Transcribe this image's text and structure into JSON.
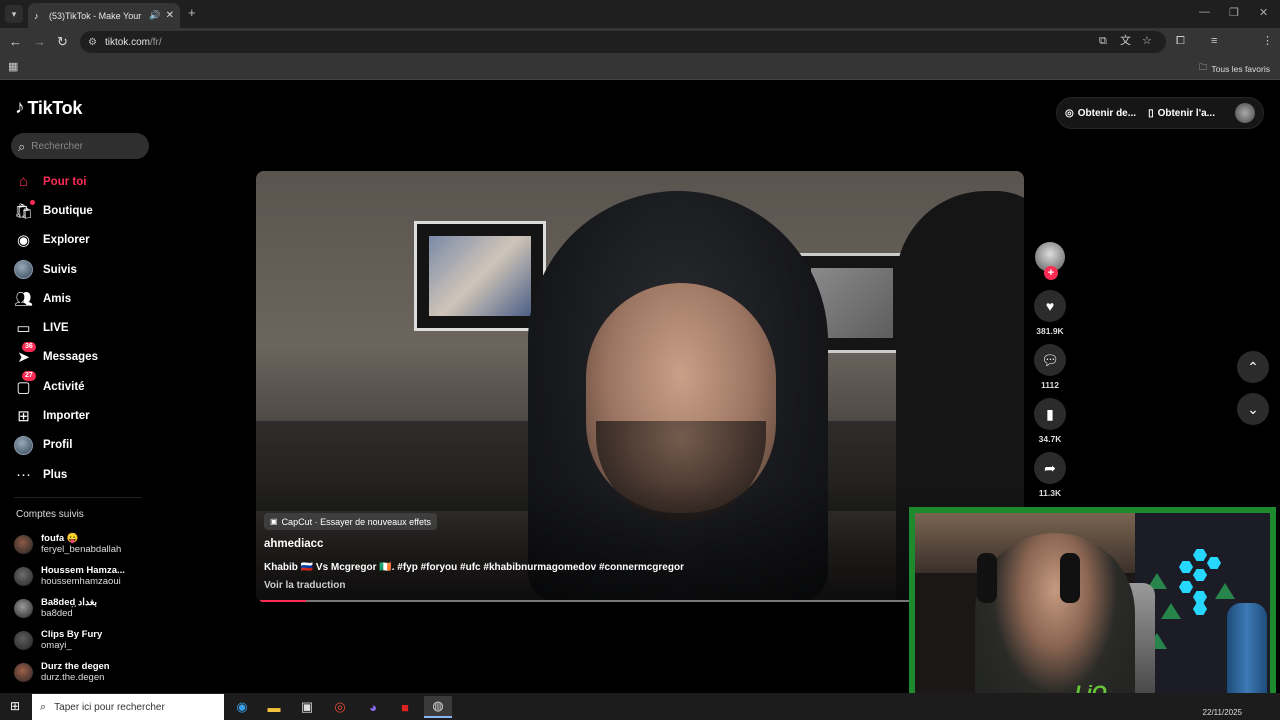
{
  "browser": {
    "tab_title": "(53)TikTok - Make Your Day",
    "url_host": "tiktok.com",
    "url_path": "/fr/",
    "bookmarks_all": "Tous les favoris"
  },
  "tiktok": {
    "logo": "TikTok",
    "search_placeholder": "Rechercher",
    "nav": [
      {
        "label": "Pour toi",
        "icon": "home-icon",
        "active": true
      },
      {
        "label": "Boutique",
        "icon": "shop-icon"
      },
      {
        "label": "Explorer",
        "icon": "compass-icon"
      },
      {
        "label": "Suivis",
        "icon": "following-avatar-icon"
      },
      {
        "label": "Amis",
        "icon": "friends-icon"
      },
      {
        "label": "LIVE",
        "icon": "live-icon"
      },
      {
        "label": "Messages",
        "icon": "messages-icon",
        "badge": "36"
      },
      {
        "label": "Activité",
        "icon": "activity-icon",
        "badge": "27"
      },
      {
        "label": "Importer",
        "icon": "upload-icon"
      },
      {
        "label": "Profil",
        "icon": "profile-icon"
      },
      {
        "label": "Plus",
        "icon": "more-icon"
      }
    ],
    "following_title": "Comptes suivis",
    "following": [
      {
        "name": "foufa 😛",
        "user": "feryel_benabdallah",
        "color": "#8a5a46"
      },
      {
        "name": "Houssem Hamza...",
        "user": "houssemhamzaoui",
        "color": "#6d6d6d"
      },
      {
        "name": "Ba8ded᷊᷊᷊ بغداد",
        "user": "ba8ded",
        "color": "#9a9a9a"
      },
      {
        "name": "Clips By Fury",
        "user": "omayi_",
        "color": "#5e5e5e"
      },
      {
        "name": "Durz the degen",
        "user": "durz.the.degen",
        "color": "#a0604a"
      }
    ],
    "top_actions": [
      {
        "label": "Obtenir de...",
        "icon": "coin-icon"
      },
      {
        "label": "Obtenir l'a...",
        "icon": "phone-icon"
      }
    ],
    "video": {
      "effect_label": "CapCut · Essayer de nouveaux effets",
      "author": "ahmediacc",
      "caption": "Khabib 🇷🇺 Vs Mcgregor 🇮🇪. #fyp #foryou #ufc #khabibnurmagomedov #connermcgregor",
      "translate": "Voir la traduction",
      "progress": 0.06
    },
    "actions": {
      "likes": "381.9K",
      "comments": "1112",
      "saves": "34.7K",
      "shares": "11.3K"
    }
  },
  "taskbar": {
    "search_placeholder": "Taper ici pour rechercher",
    "date": "22/11/2025"
  },
  "colors": {
    "accent": "#fe2c55",
    "cam_frame": "#1d8a2d"
  }
}
